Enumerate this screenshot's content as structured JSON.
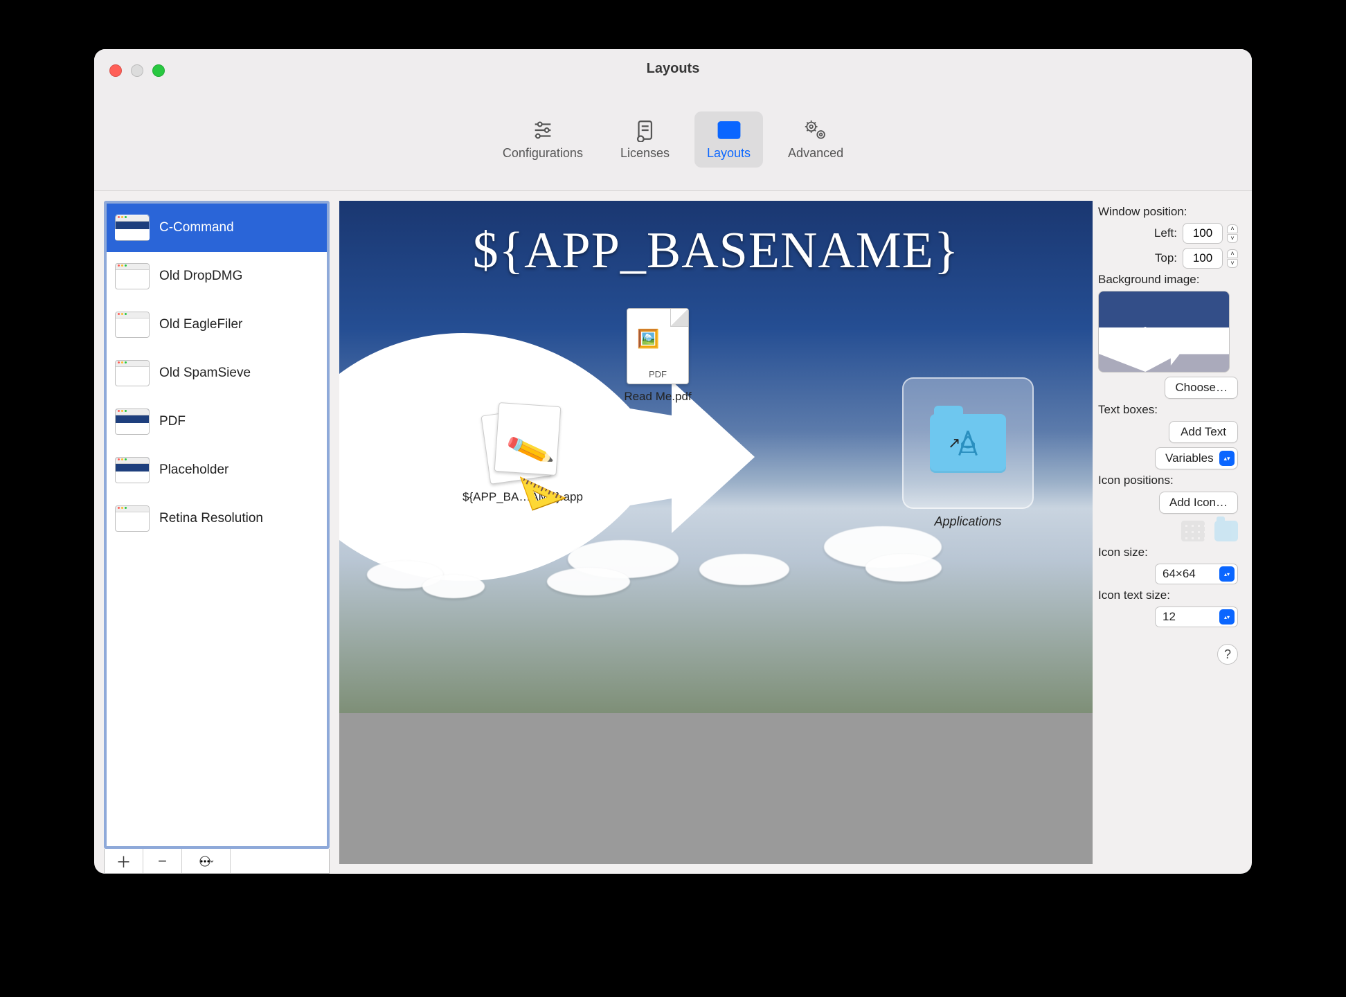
{
  "window": {
    "title": "Layouts"
  },
  "toolbar": {
    "tabs": [
      {
        "label": "Configurations"
      },
      {
        "label": "Licenses"
      },
      {
        "label": "Layouts",
        "selected": true
      },
      {
        "label": "Advanced"
      }
    ]
  },
  "sidebar": {
    "items": [
      "C-Command",
      "Old DropDMG",
      "Old EagleFiler",
      "Old SpamSieve",
      "PDF",
      "Placeholder",
      "Retina Resolution"
    ],
    "selected_index": 0
  },
  "canvas": {
    "title": "${APP_BASENAME}",
    "items": [
      {
        "label": "${APP_BA…AME}.app",
        "kind": "application"
      },
      {
        "label": "Read Me.pdf",
        "badge": "PDF",
        "kind": "pdf"
      },
      {
        "label": "Applications",
        "kind": "folder-alias",
        "selected": true
      }
    ]
  },
  "panel": {
    "window_position_label": "Window position:",
    "left_label": "Left:",
    "left_value": "100",
    "top_label": "Top:",
    "top_value": "100",
    "background_label": "Background image:",
    "choose_button": "Choose…",
    "textboxes_label": "Text boxes:",
    "add_text_button": "Add Text",
    "variables_button": "Variables",
    "icon_positions_label": "Icon positions:",
    "add_icon_button": "Add Icon…",
    "icon_size_label": "Icon size:",
    "icon_size_value": "64×64",
    "icon_text_size_label": "Icon text size:",
    "icon_text_size_value": "12"
  }
}
